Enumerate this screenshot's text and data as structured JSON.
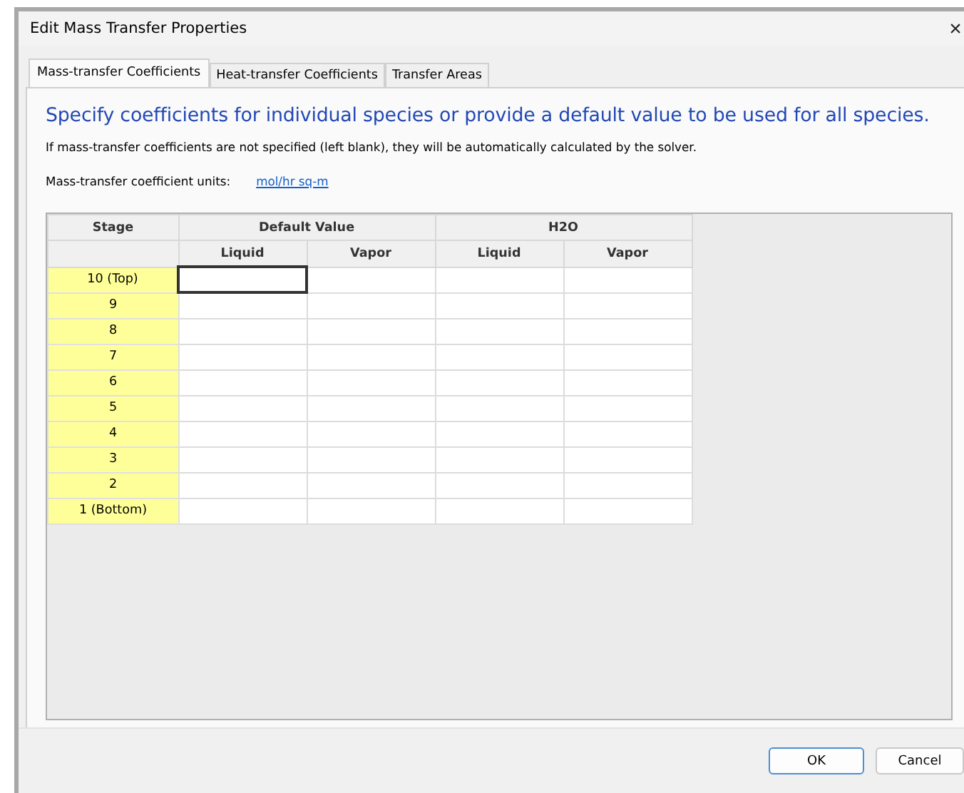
{
  "window": {
    "title": "Edit Mass Transfer Properties",
    "close": "×"
  },
  "tabs": [
    {
      "label": "Mass-transfer Coefficients",
      "selected": true
    },
    {
      "label": "Heat-transfer Coefficients",
      "selected": false
    },
    {
      "label": "Transfer Areas",
      "selected": false
    }
  ],
  "heading": "Specify coefficients for individual species or provide a default value to be used for all species.",
  "note": "If mass-transfer coefficients are not specified (left blank), they will be automatically calculated by the solver.",
  "units": {
    "label": "Mass-transfer coefficient units:",
    "link": "mol/hr sq-m"
  },
  "table": {
    "stage_header": "Stage",
    "groups": [
      {
        "name": "Default Value",
        "columns": [
          "Liquid",
          "Vapor"
        ]
      },
      {
        "name": "H2O",
        "columns": [
          "Liquid",
          "Vapor"
        ]
      }
    ],
    "rows": [
      {
        "stage": "10 (Top)",
        "cells": [
          {
            "selected": true
          },
          {
            "selected": false
          },
          {
            "selected": false
          },
          {
            "selected": false
          }
        ]
      },
      {
        "stage": "9",
        "cells": [
          {
            "selected": false
          },
          {
            "selected": false
          },
          {
            "selected": false
          },
          {
            "selected": false
          }
        ]
      },
      {
        "stage": "8",
        "cells": [
          {
            "selected": false
          },
          {
            "selected": false
          },
          {
            "selected": false
          },
          {
            "selected": false
          }
        ]
      },
      {
        "stage": "7",
        "cells": [
          {
            "selected": false
          },
          {
            "selected": false
          },
          {
            "selected": false
          },
          {
            "selected": false
          }
        ]
      },
      {
        "stage": "6",
        "cells": [
          {
            "selected": false
          },
          {
            "selected": false
          },
          {
            "selected": false
          },
          {
            "selected": false
          }
        ]
      },
      {
        "stage": "5",
        "cells": [
          {
            "selected": false
          },
          {
            "selected": false
          },
          {
            "selected": false
          },
          {
            "selected": false
          }
        ]
      },
      {
        "stage": "4",
        "cells": [
          {
            "selected": false
          },
          {
            "selected": false
          },
          {
            "selected": false
          },
          {
            "selected": false
          }
        ]
      },
      {
        "stage": "3",
        "cells": [
          {
            "selected": false
          },
          {
            "selected": false
          },
          {
            "selected": false
          },
          {
            "selected": false
          }
        ]
      },
      {
        "stage": "2",
        "cells": [
          {
            "selected": false
          },
          {
            "selected": false
          },
          {
            "selected": false
          },
          {
            "selected": false
          }
        ]
      },
      {
        "stage": "1 (Bottom)",
        "cells": [
          {
            "selected": false
          },
          {
            "selected": false
          },
          {
            "selected": false
          },
          {
            "selected": false
          }
        ]
      }
    ]
  },
  "buttons": [
    {
      "label": "OK",
      "kind": "default"
    },
    {
      "label": "Cancel",
      "kind": "normal"
    }
  ]
}
